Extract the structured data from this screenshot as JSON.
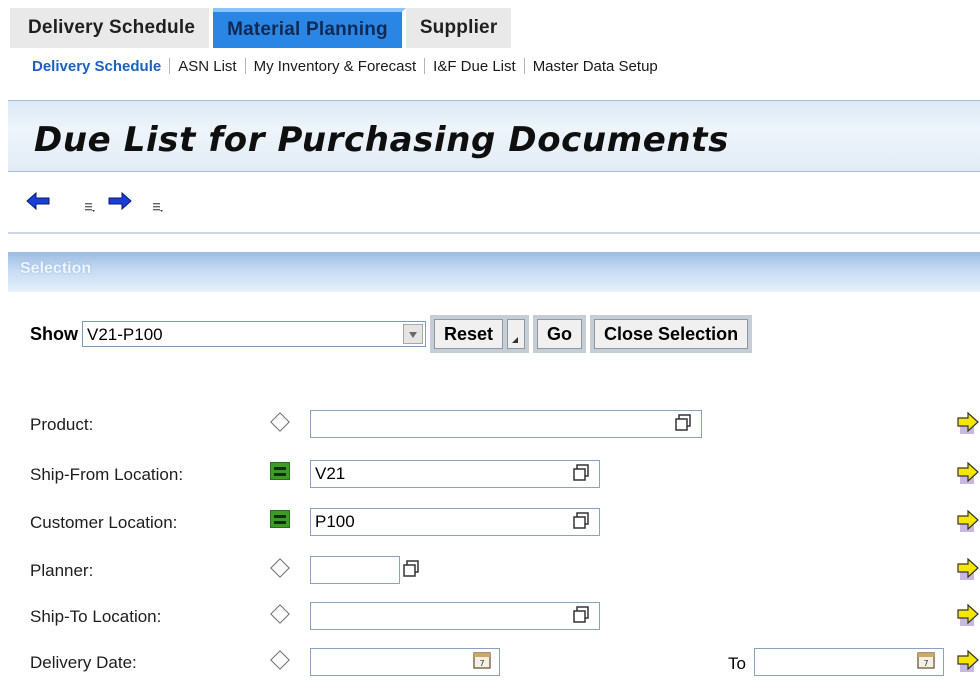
{
  "top_tabs": [
    "Delivery Schedule",
    "Material Planning",
    "Supplier"
  ],
  "sub_nav": [
    "Delivery Schedule",
    "ASN List",
    "My Inventory & Forecast",
    "I&F Due List",
    "Master Data Setup"
  ],
  "page_title": "Due List for Purchasing Documents",
  "section_title": "Selection",
  "show": {
    "label": "Show",
    "value": "V21-P100"
  },
  "buttons": {
    "reset": "Reset",
    "go": "Go",
    "close_selection": "Close Selection"
  },
  "fields": {
    "product": {
      "label": "Product:",
      "value": ""
    },
    "ship_from": {
      "label": "Ship-From Location:",
      "value": "V21"
    },
    "customer": {
      "label": "Customer Location:",
      "value": "P100"
    },
    "planner": {
      "label": "Planner:",
      "value": ""
    },
    "ship_to": {
      "label": "Ship-To Location:",
      "value": ""
    },
    "delivery_date": {
      "label": "Delivery Date:",
      "value": "",
      "to_label": "To",
      "to_value": ""
    }
  },
  "colors": {
    "active_tab": "#2a86e5",
    "selected_subnav": "#1b62c0",
    "include_icon": "#3d9a25",
    "arrow": "#f4e600"
  }
}
